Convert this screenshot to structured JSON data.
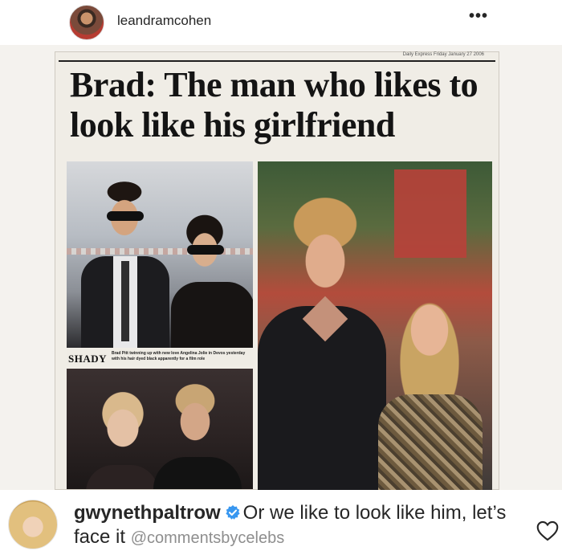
{
  "header": {
    "username": "leandramcohen",
    "more_label": "•••"
  },
  "post": {
    "headline": "Brad: The man who likes to look like his girlfriend",
    "caption_label": "SHADY",
    "caption_text": "Brad Pitt twinning up with new love Angelina Jolie in Devos yesterday with his hair dyed black apparently for a film role",
    "dateline": "Daily Express  Friday January 27 2006"
  },
  "comment": {
    "username": "gwynethpaltrow",
    "text": "Or we like to look like him, let’s face it",
    "tag": "@commentsbycelebs",
    "verified_icon": "verified-badge",
    "like_icon": "heart-outline"
  },
  "colors": {
    "verified": "#3897f0",
    "text": "#262626",
    "muted": "#8e8e8e"
  }
}
